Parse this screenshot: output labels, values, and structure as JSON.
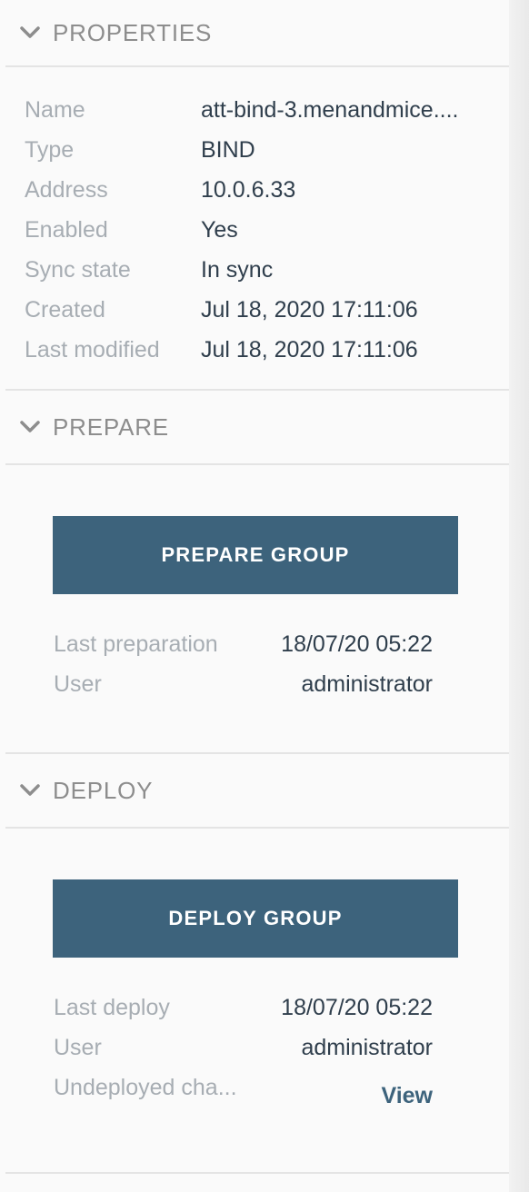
{
  "properties": {
    "title": "PROPERTIES",
    "rows": [
      {
        "label": "Name",
        "value": "att-bind-3.menandmice...."
      },
      {
        "label": "Type",
        "value": "BIND"
      },
      {
        "label": "Address",
        "value": "10.0.6.33"
      },
      {
        "label": "Enabled",
        "value": "Yes"
      },
      {
        "label": "Sync state",
        "value": "In sync"
      },
      {
        "label": "Created",
        "value": "Jul 18, 2020 17:11:06"
      },
      {
        "label": "Last modified",
        "value": "Jul 18, 2020 17:11:06"
      }
    ]
  },
  "prepare": {
    "title": "PREPARE",
    "button_label": "PREPARE GROUP",
    "last_preparation_label": "Last preparation",
    "last_preparation_value": "18/07/20 05:22",
    "user_label": "User",
    "user_value": "administrator"
  },
  "deploy": {
    "title": "DEPLOY",
    "button_label": "DEPLOY GROUP",
    "last_deploy_label": "Last deploy",
    "last_deploy_value": "18/07/20 05:22",
    "user_label": "User",
    "user_value": "administrator",
    "undeployed_label": "Undeployed cha...",
    "view_link": "View"
  },
  "colors": {
    "accent": "#3d637c",
    "label": "#a7adb3",
    "value": "#2f3e4c",
    "header": "#8d8d8d"
  },
  "icons": {
    "section_toggle": "chevron-down-icon"
  }
}
